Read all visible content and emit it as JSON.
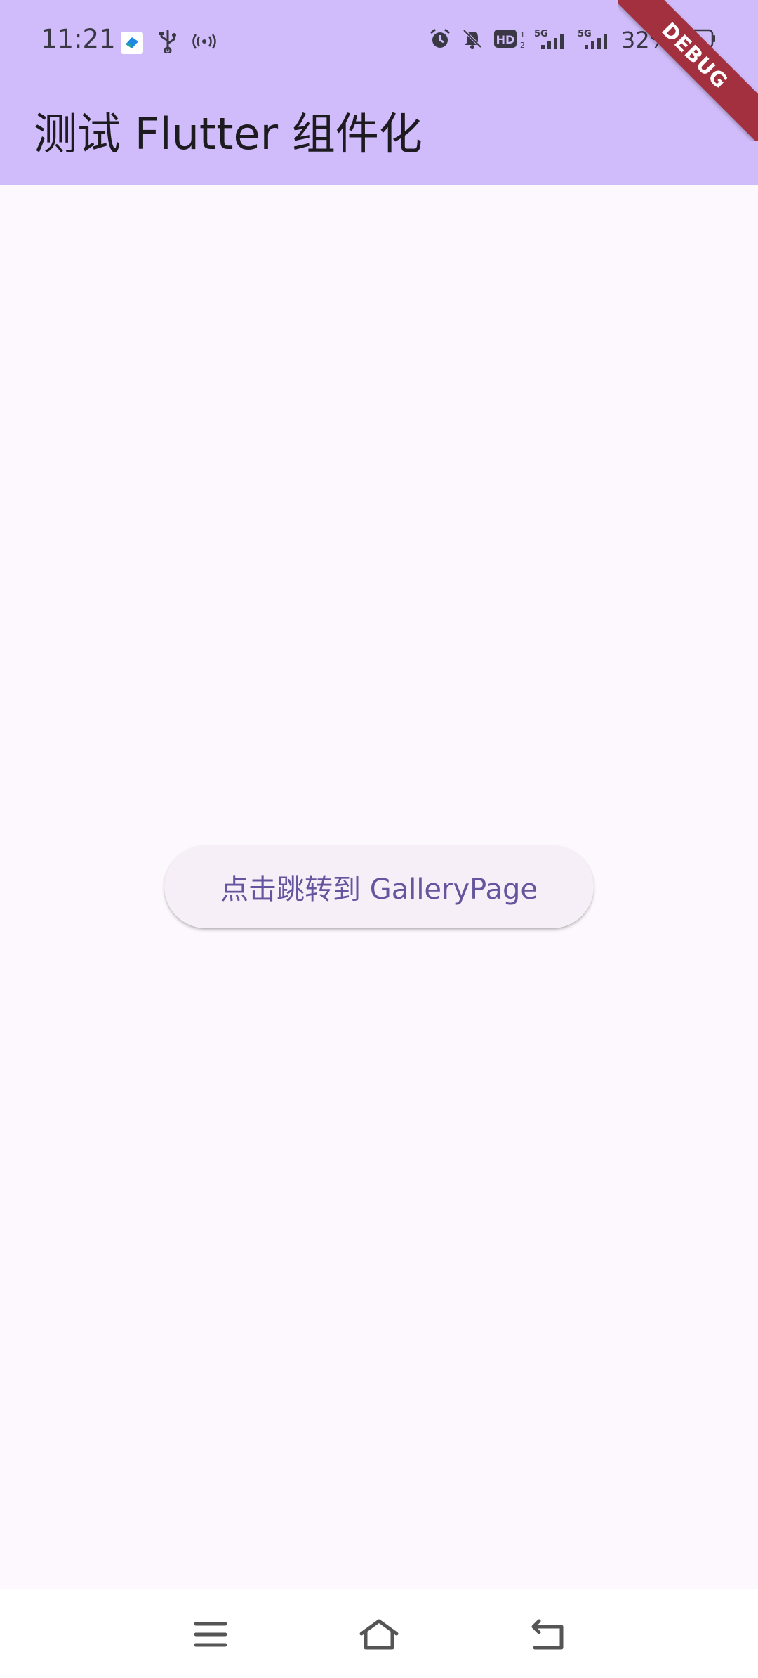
{
  "status_bar": {
    "time": "11:21",
    "battery": "32%",
    "network_labels": [
      "5G",
      "5G"
    ],
    "hd_label": "HD"
  },
  "app_bar": {
    "title": "测试 Flutter 组件化"
  },
  "debug_banner": {
    "label": "DEBUG"
  },
  "main": {
    "nav_button_label": "点击跳转到 GalleryPage"
  },
  "system_nav": {
    "items": [
      "menu-icon",
      "home-icon",
      "back-icon"
    ]
  },
  "colors": {
    "app_bar_bg": "#d0bcfa",
    "page_bg": "#fdf8fd",
    "button_bg": "#f6eff7",
    "button_text": "#65559e",
    "debug_ribbon": "#a3303f"
  }
}
